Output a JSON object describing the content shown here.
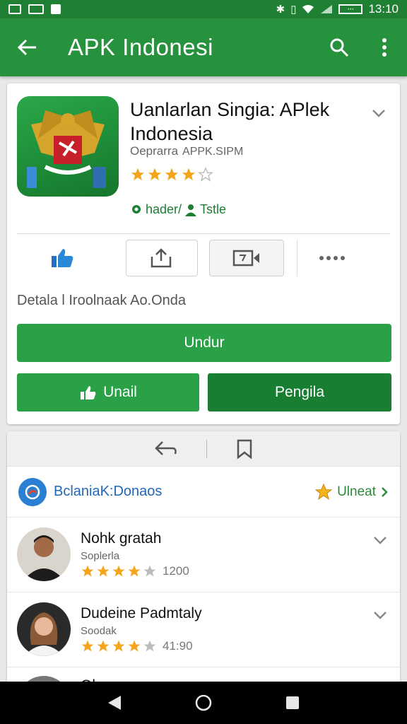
{
  "status_bar": {
    "time": "13:10",
    "battery_label": "···"
  },
  "app_bar": {
    "title": "APK Indonesi"
  },
  "app": {
    "title": "Uanlarlan Singia: APlek Indonesia",
    "developer": "Oeprarra",
    "developer_sub": "APPK.SIPM",
    "rating_stars": 4,
    "install_label": "hader/",
    "install_sub": "Tstle",
    "detail_text": "Detala l Iroolnaak Ao.Onda",
    "primary_button": "Undur",
    "left_button": "Unail",
    "right_button": "Pengila"
  },
  "section": {
    "title": "BclaniaK:Donaos",
    "link_label": "Ulneat"
  },
  "reviews": [
    {
      "name": "Nohk gratah",
      "sub": "Soplerla",
      "stars": 4,
      "count": "1200"
    },
    {
      "name": "Dudeine Padmtaly",
      "sub": "Soodak",
      "stars": 4,
      "count": "41:90"
    }
  ],
  "peek_review": {
    "name": "Ol..."
  },
  "colors": {
    "brand_green": "#27923d",
    "dark_green": "#177e32",
    "star": "#f4a51c",
    "link_blue": "#2167b8"
  }
}
